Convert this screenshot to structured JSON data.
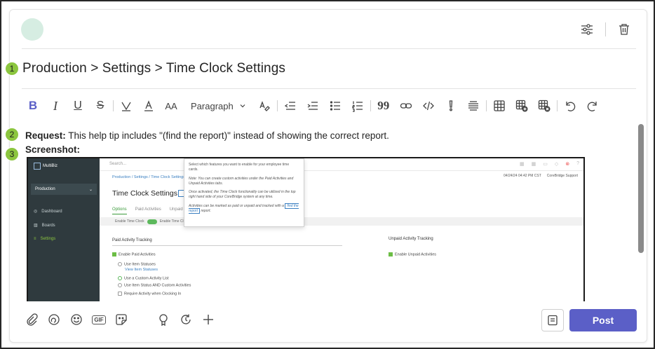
{
  "title": "Production > Settings > Time Clock Settings",
  "toolbar": {
    "bold": "B",
    "italic": "I",
    "underline": "U",
    "strikethrough": "S",
    "font_size": "AA",
    "paragraph": "Paragraph",
    "quote": "99"
  },
  "badges": [
    "1",
    "2",
    "3"
  ],
  "request": {
    "label": "Request:",
    "text": " This help tip includes \"(find the report)\" instead of showing the correct report."
  },
  "screenshot_label": "Screenshot:",
  "screenshot": {
    "search": "Search...",
    "logo": "MultiBiz",
    "sidebar": [
      "Production",
      "Dashboard",
      "Boards",
      "Settings"
    ],
    "breadcrumb": "Production / Settings / Time Clock Settings",
    "heading": "Time Clock Settings",
    "tabs": [
      "Options",
      "Paid Activities",
      "Unpaid"
    ],
    "strip_left": "Enable Time Clock",
    "strip_right": "Enable Time Cl",
    "date": "04/24/24 04:42 PM CST",
    "support": "CoreBridge Support",
    "paid_header": "Paid Activity Tracking",
    "unpaid_header": "Unpaid Activity Tracking",
    "enable_paid": "Enable Paid Activities",
    "enable_unpaid": "Enable Unpaid Activities",
    "use_item": "Use Item Statuses",
    "view_item": "View Item Statuses",
    "use_custom": "Use a Custom Activity List",
    "use_both": "Use Item Status AND Custom Activities",
    "require": "Require Activity when Clocking In",
    "tip": {
      "p1": "Select which features you want to enable for your employee time cards.",
      "p2": "Note: You can create custom activities under the Paid Activities and Unpaid Activities tabs.",
      "p3": "Once activated, the Time Clock functionality can be utilized in the top right hand side of your CoreBridge system at any time.",
      "p4a": "Activities can be marked as paid or unpaid and tracked with a",
      "p4b": "find the report",
      "p4c": " report."
    }
  },
  "post_label": "Post"
}
